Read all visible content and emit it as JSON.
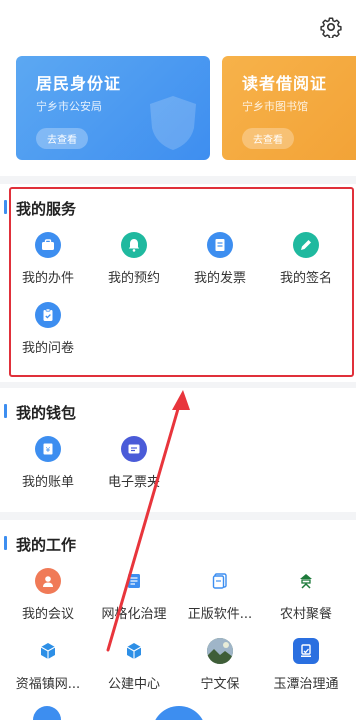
{
  "cards": [
    {
      "title": "居民身份证",
      "subtitle": "宁乡市公安局",
      "button": "去查看",
      "color": "#4a99f1"
    },
    {
      "title": "读者借阅证",
      "subtitle": "宁乡市图书馆",
      "button": "去查看",
      "color": "#f4a93f"
    }
  ],
  "services": {
    "title": "我的服务",
    "items": [
      {
        "label": "我的办件",
        "icon": "briefcase-icon",
        "color": "#3d8ef0"
      },
      {
        "label": "我的预约",
        "icon": "bell-icon",
        "color": "#1fb99f"
      },
      {
        "label": "我的发票",
        "icon": "receipt-icon",
        "color": "#3d8ef0"
      },
      {
        "label": "我的签名",
        "icon": "pen-icon",
        "color": "#1fb99f"
      },
      {
        "label": "我的问卷",
        "icon": "clipboard-icon",
        "color": "#3d8ef0"
      }
    ]
  },
  "wallet": {
    "title": "我的钱包",
    "items": [
      {
        "label": "我的账单",
        "icon": "bill-icon",
        "color": "#3d8ef0"
      },
      {
        "label": "电子票夹",
        "icon": "ticket-icon",
        "color": "#4a5bd8"
      }
    ]
  },
  "work": {
    "title": "我的工作",
    "items": [
      {
        "label": "我的会议",
        "icon": "meeting-icon",
        "color": "#f07a57"
      },
      {
        "label": "网格化治理",
        "icon": "grid-doc-icon",
        "color": "#3d8ef0"
      },
      {
        "label": "正版软件...",
        "icon": "software-icon",
        "color": "#3d8ef0"
      },
      {
        "label": "农村聚餐",
        "icon": "food-icon",
        "color": "#1d7a3a"
      },
      {
        "label": "资福镇网...",
        "icon": "cube-icon",
        "color": "#2d8fe6"
      },
      {
        "label": "公建中心",
        "icon": "cube-icon",
        "color": "#2d8fe6"
      },
      {
        "label": "宁文保",
        "icon": "landscape-icon",
        "color": "#557a4a"
      },
      {
        "label": "玉潭治理通",
        "icon": "app-icon",
        "color": "#2a6fe0"
      }
    ]
  }
}
